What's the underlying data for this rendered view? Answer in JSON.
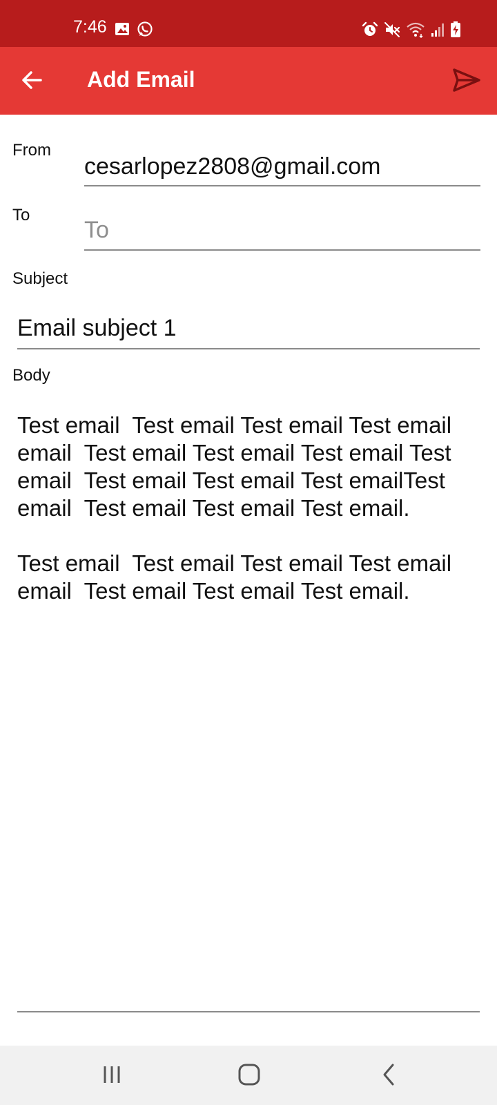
{
  "status_bar": {
    "time": "7:46",
    "left_icons": [
      "image-icon",
      "whatsapp-icon"
    ],
    "right_icons": [
      "alarm-icon",
      "mute-icon",
      "wifi-icon",
      "signal-icon",
      "battery-charging-icon"
    ]
  },
  "app_bar": {
    "title": "Add Email",
    "back_icon": "arrow-back-icon",
    "send_icon": "send-icon"
  },
  "form": {
    "from_label": "From",
    "from_value": "cesarlopez2808@gmail.com",
    "to_label": "To",
    "to_placeholder": "To",
    "subject_label": "Subject",
    "subject_value": "Email subject 1",
    "body_label": "Body",
    "body_value": "Test email  Test email Test email Test email email  Test email Test email Test email Test email  Test email Test email Test emailTest email  Test email Test email Test email.\n\nTest email  Test email Test email Test email email  Test email Test email Test email."
  },
  "nav_bar": {
    "recents_icon": "recents-icon",
    "home_icon": "home-icon",
    "back_icon": "back-chevron-icon"
  },
  "colors": {
    "status_bar": "#B71C1C",
    "app_bar": "#E53935",
    "send_icon": "#7A1010"
  }
}
